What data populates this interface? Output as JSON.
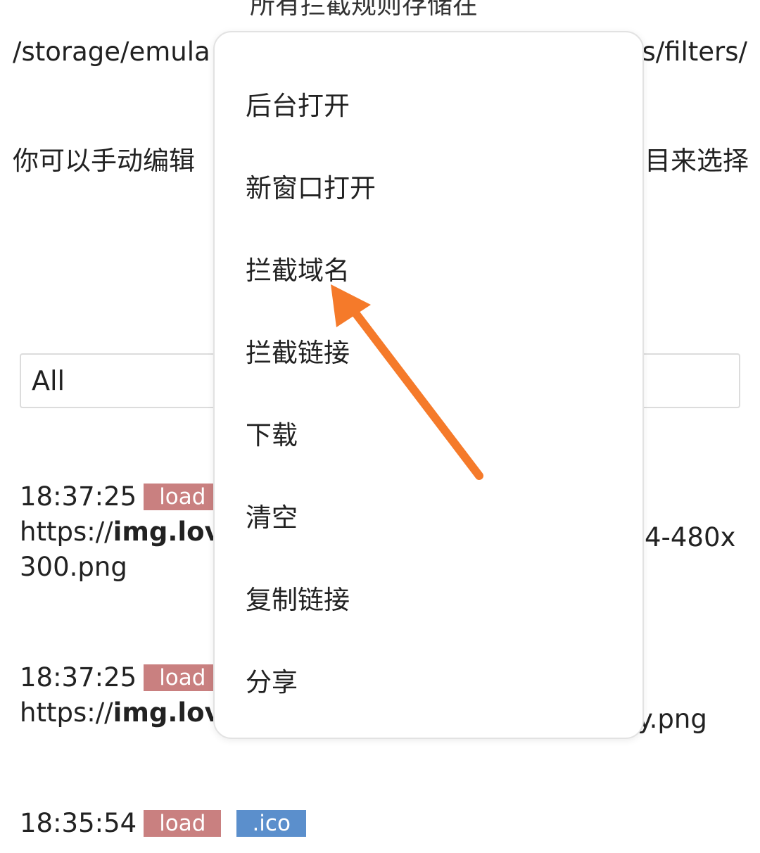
{
  "header": {
    "title_partial": "所有拦截规则存储在",
    "path_left": "/storage/emula",
    "path_right": "s/filters/",
    "hint_left": "你可以手动编辑",
    "hint_right": "目来选择"
  },
  "filter": {
    "selected": "All"
  },
  "logs": [
    {
      "time": "18:37:25",
      "type_badge": "load",
      "url_prefix": "https://",
      "url_host_partial": "img.love",
      "url_tail": "4-480x",
      "url_line2": "300.png"
    },
    {
      "time": "18:37:25",
      "type_badge": "load",
      "url_prefix": "https://",
      "url_host_partial": "img.love",
      "url_tail": "y.png"
    },
    {
      "time": "18:35:54",
      "type_badge": "load",
      "ext_badge": ".ico"
    }
  ],
  "context_menu": {
    "items": [
      {
        "label": "后台打开"
      },
      {
        "label": "新窗口打开"
      },
      {
        "label": "拦截域名"
      },
      {
        "label": "拦截链接"
      },
      {
        "label": "下载"
      },
      {
        "label": "清空"
      },
      {
        "label": "复制链接"
      },
      {
        "label": "分享"
      }
    ]
  },
  "annotation": {
    "arrow_color": "#f57a2a",
    "icon": "arrow-annotation-icon"
  },
  "colors": {
    "badge_load": "#c98080",
    "badge_ico": "#5b8fcc"
  }
}
